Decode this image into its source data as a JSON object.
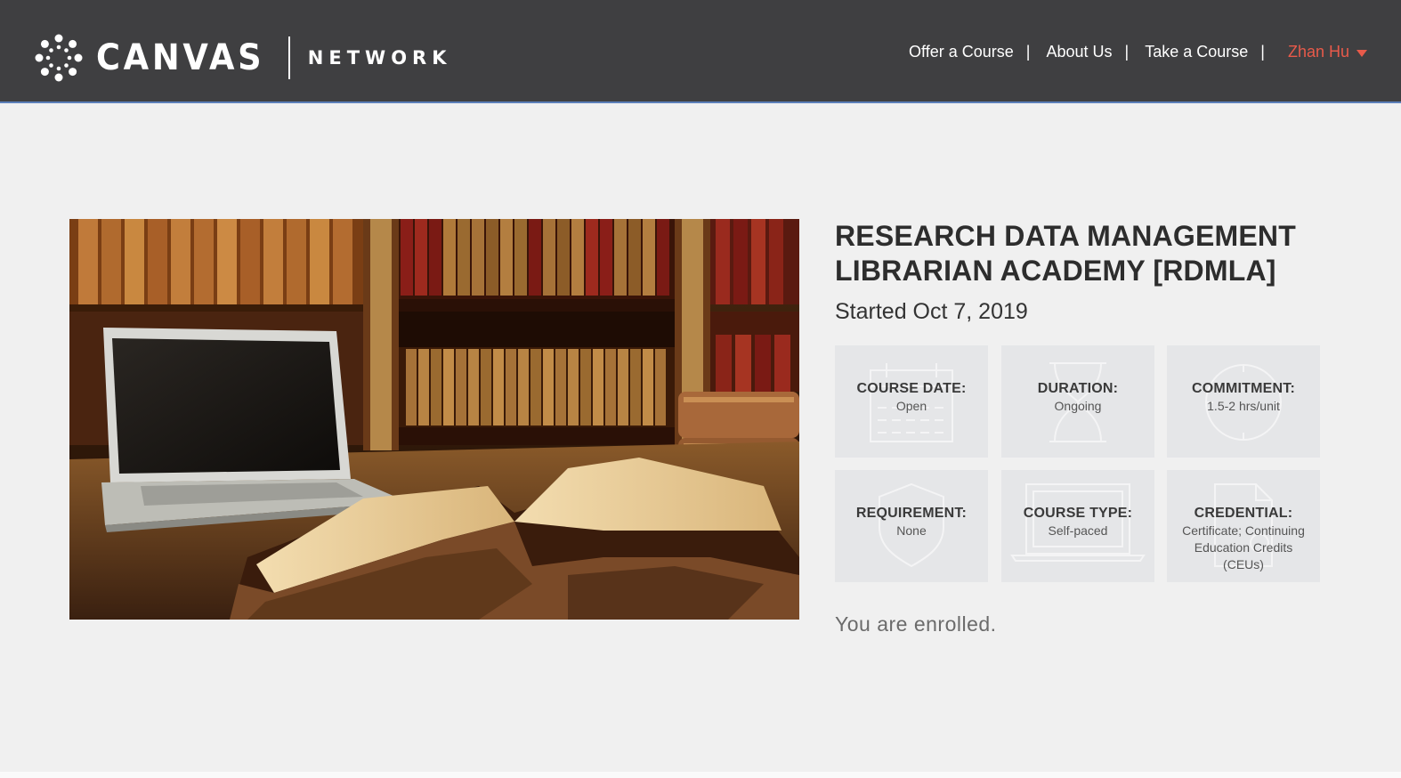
{
  "header": {
    "logo_wordmark": "CANVAS",
    "logo_network": "NETWORK",
    "nav": [
      {
        "label": "Offer a Course"
      },
      {
        "label": "About Us"
      },
      {
        "label": "Take a Course"
      }
    ],
    "user": "Zhan Hu",
    "background_color": "#3f3f41",
    "user_color": "#e85a4a"
  },
  "hero_image": {
    "icon": "library-books-laptop-photo"
  },
  "course": {
    "title": "RESEARCH DATA MANAGEMENT LIBRARIAN ACADEMY [RDMLA]",
    "started": "Started Oct 7, 2019",
    "details": [
      {
        "label": "COURSE DATE:",
        "value": "Open",
        "icon": "calendar-icon"
      },
      {
        "label": "DURATION:",
        "value": "Ongoing",
        "icon": "hourglass-icon"
      },
      {
        "label": "COMMITMENT:",
        "value": "1.5-2 hrs/unit",
        "icon": "clock-icon"
      },
      {
        "label": "REQUIREMENT:",
        "value": "None",
        "icon": "shield-icon"
      },
      {
        "label": "COURSE TYPE:",
        "value": "Self-paced",
        "icon": "laptop-icon"
      },
      {
        "label": "CREDENTIAL:",
        "value": "Certificate; Continuing Education Credits (CEUs)",
        "icon": "document-icon"
      }
    ],
    "status": "You are enrolled."
  }
}
